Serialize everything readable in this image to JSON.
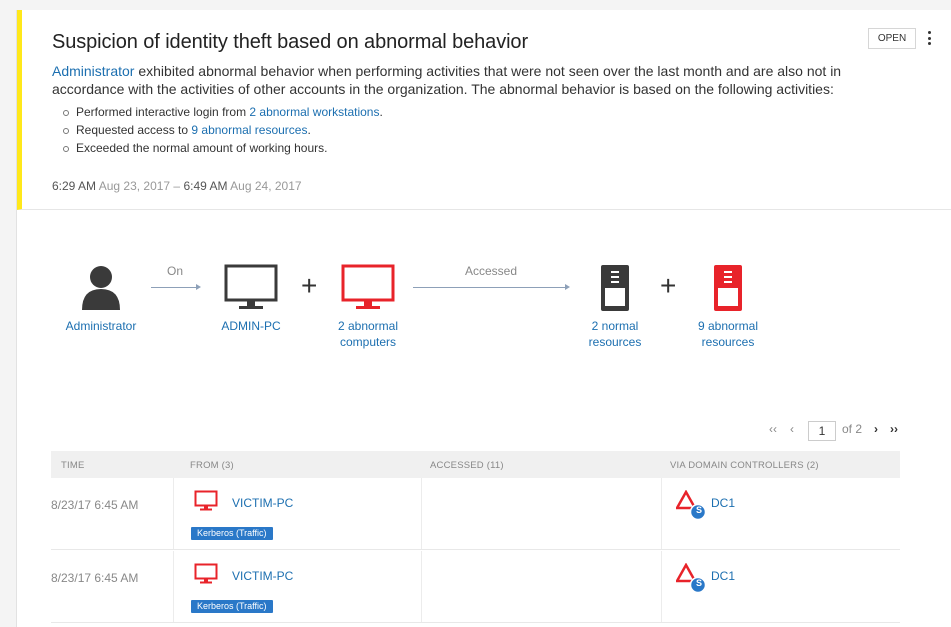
{
  "alert": {
    "title": "Suspicion of identity theft based on abnormal behavior",
    "status": "OPEN",
    "desc_user": "Administrator",
    "desc_line1": " exhibited abnormal behavior when performing activities that were not seen over the last month and are also not in",
    "desc_line2": "accordance with the activities of other accounts in the organization. The abnormal behavior is based on the following activities:",
    "activities": [
      {
        "prefix": "Performed interactive login from ",
        "link": "2 abnormal workstations",
        "suffix": "."
      },
      {
        "prefix": "Requested access to ",
        "link": "9 abnormal resources",
        "suffix": "."
      },
      {
        "prefix": "Exceeded the normal amount of working hours.",
        "link": "",
        "suffix": ""
      }
    ],
    "time_start": "6:29 AM",
    "date_start": " Aug 23, 2017 – ",
    "time_end": "6:49 AM",
    "date_end": " Aug 24, 2017"
  },
  "diagram": {
    "user": "Administrator",
    "arrow1": "On",
    "pc": "ADMIN-PC",
    "abnormal_pc_1": "2 abnormal",
    "abnormal_pc_2": "computers",
    "arrow2": "Accessed",
    "normal_res_1": "2 normal",
    "normal_res_2": "resources",
    "abnormal_res_1": "9 abnormal",
    "abnormal_res_2": "resources",
    "plus": "+"
  },
  "pager": {
    "first": "‹‹",
    "prev": "‹",
    "page": "1",
    "of": "of 2",
    "next": "›",
    "last": "››"
  },
  "table": {
    "headers": {
      "time": "TIME",
      "from": "FROM (3)",
      "accessed": "ACCESSED (11)",
      "via": "VIA DOMAIN CONTROLLERS (2)"
    },
    "rows": [
      {
        "time": "8/23/17 6:45 AM",
        "from": "VICTIM-PC",
        "protocol": "Kerberos (Traffic)",
        "dc": "DC1",
        "dc_badge": "S"
      },
      {
        "time": "8/23/17 6:45 AM",
        "from": "VICTIM-PC",
        "protocol": "Kerberos (Traffic)",
        "dc": "DC1",
        "dc_badge": "S"
      }
    ]
  },
  "colors": {
    "accent_bar": "#ffe81a",
    "link": "#1c6fb0",
    "abnormal": "#e8232a",
    "tag": "#2a78c8"
  }
}
